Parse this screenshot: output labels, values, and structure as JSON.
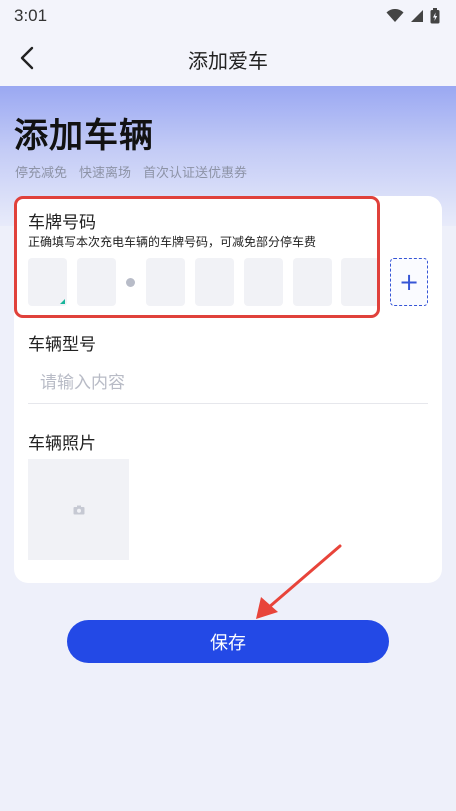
{
  "status_bar": {
    "time": "3:01"
  },
  "nav": {
    "title": "添加爱车"
  },
  "hero": {
    "title": "添加车辆",
    "benefits": [
      "停充减免",
      "快速离场",
      "首次认证送优惠券"
    ]
  },
  "plate": {
    "label": "车牌号码",
    "hint": "正确填写本次充电车辆的车牌号码，可减免部分停车费",
    "add_symbol": "+"
  },
  "model": {
    "label": "车辆型号",
    "placeholder": "请输入内容"
  },
  "photo": {
    "label": "车辆照片"
  },
  "actions": {
    "save_label": "保存"
  },
  "colors": {
    "primary": "#2349e6",
    "highlight": "#e0413b",
    "arrow": "#e8443a"
  }
}
